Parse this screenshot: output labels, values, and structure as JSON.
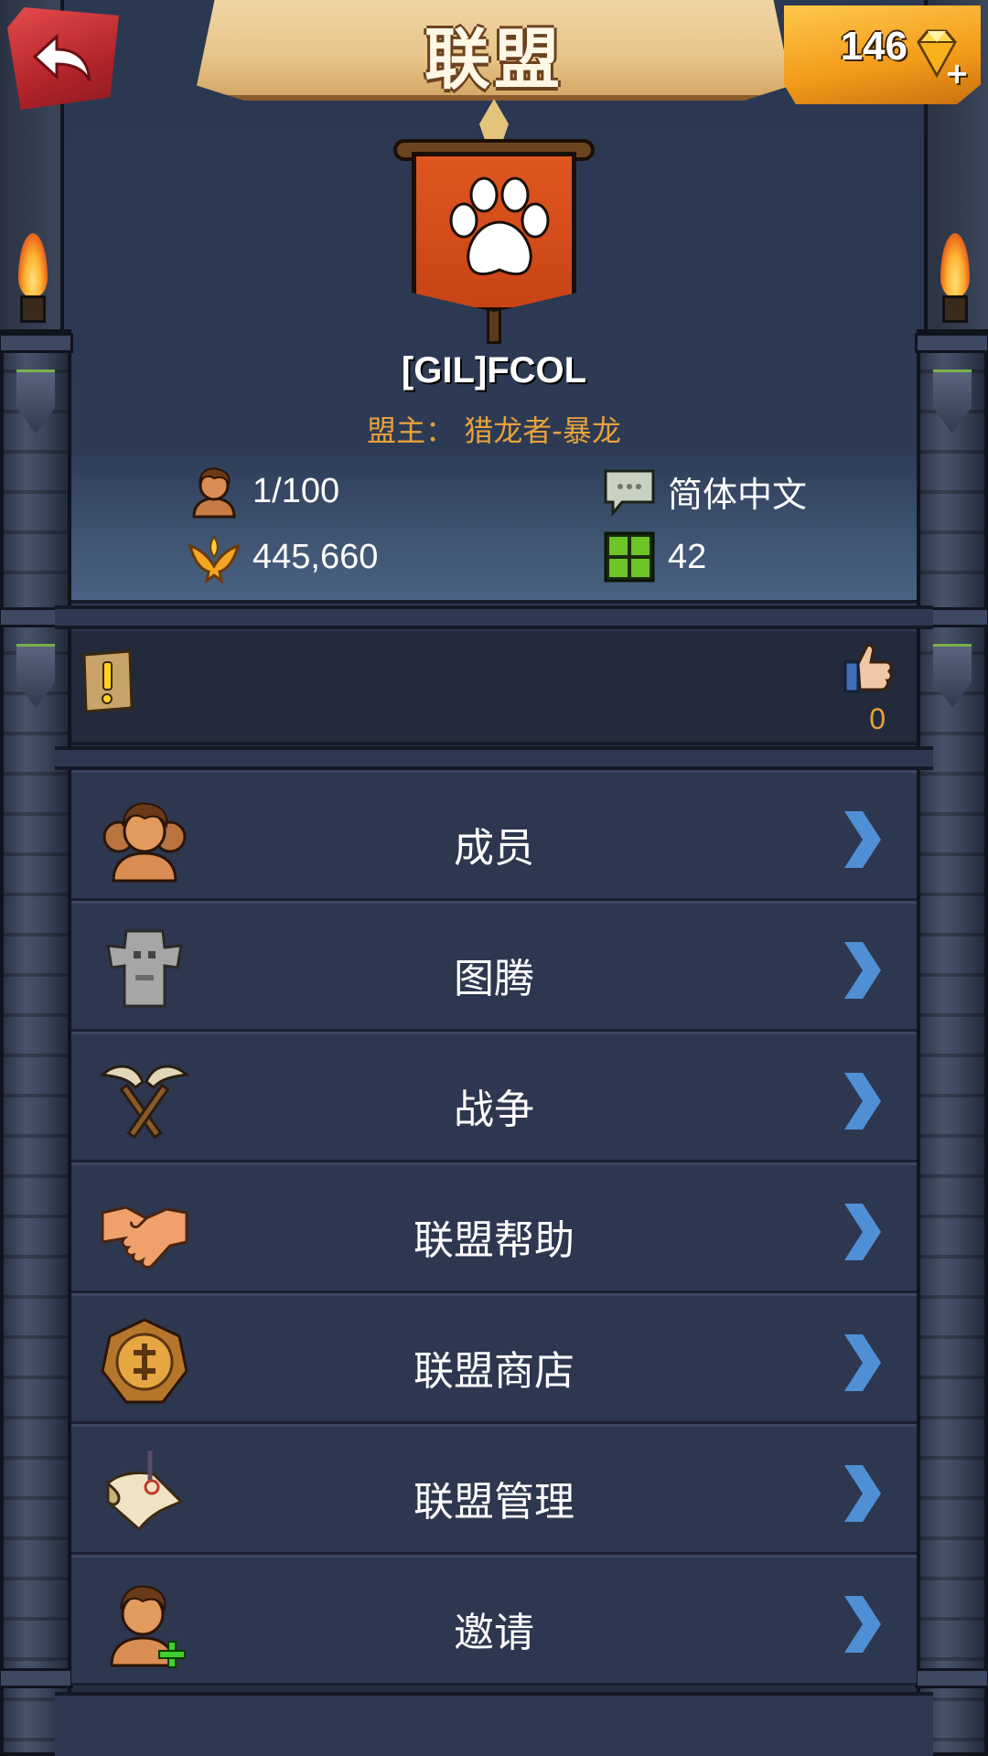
{
  "header": {
    "title": "联盟",
    "back_icon": "back-arrow-icon",
    "gems": "146",
    "gem_icon": "diamond-icon",
    "gem_plus": "+"
  },
  "alliance": {
    "name": "[GIL]FCOL",
    "leader": "盟主： 猎龙者-暴龙",
    "emblem_icon": "paw-banner-icon"
  },
  "stats": {
    "members": "1/100",
    "power": "445,660",
    "language": "简体中文",
    "territory": "42"
  },
  "notice": {
    "likes": "0"
  },
  "menu": [
    {
      "label": "成员",
      "icon": "members-icon"
    },
    {
      "label": "图腾",
      "icon": "totem-icon"
    },
    {
      "label": "战争",
      "icon": "war-axes-icon"
    },
    {
      "label": "联盟帮助",
      "icon": "handshake-icon"
    },
    {
      "label": "联盟商店",
      "icon": "shop-coin-icon"
    },
    {
      "label": "联盟管理",
      "icon": "scroll-icon"
    },
    {
      "label": "邀请",
      "icon": "invite-icon"
    }
  ],
  "colors": {
    "accent": "#e8a13b",
    "arrow": "#4e8fd6",
    "flag": "#e0561f",
    "back_button": "#c7312f",
    "gem_panel": "#f29a19"
  }
}
